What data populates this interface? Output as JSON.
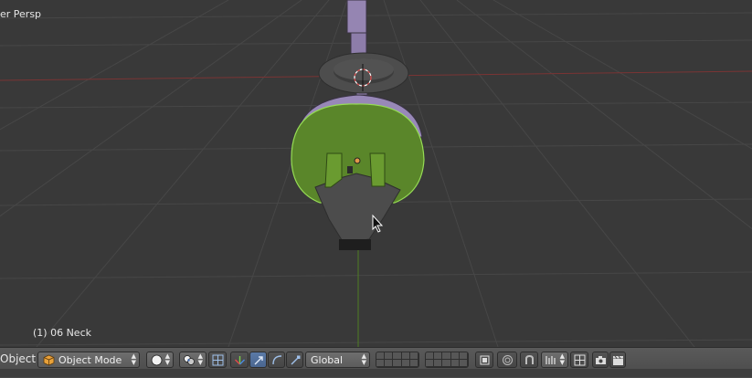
{
  "viewport": {
    "view_label": "er Persp",
    "object_label": "(1) 06 Neck"
  },
  "header": {
    "editor_label": "Object",
    "mode_selector": {
      "value": "Object Mode",
      "icon": "cube-icon"
    },
    "shading_icon": "sphere-solid-icon",
    "pivot_icon": "pivot-point-icon",
    "transform_orientation": {
      "value": "Global"
    },
    "colors": {
      "header_bg": "#4f4f4f",
      "active_button": "#5b7aa7",
      "grid_line": "#4a4a4a",
      "x_axis": "#8a3a3a",
      "y_axis": "#5d8a2a",
      "selected_outline": "#8fd14f",
      "bone_purple": "#9b8ab8",
      "mesh_green": "#5e8a2c"
    }
  }
}
